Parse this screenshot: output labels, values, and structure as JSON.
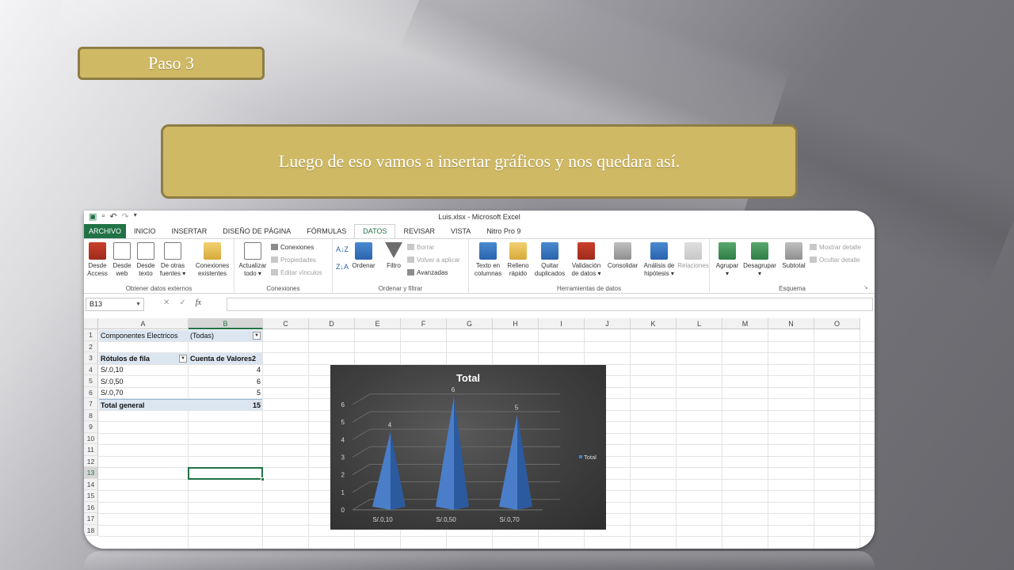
{
  "slide": {
    "step_label": "Paso 3",
    "caption": "Luego de eso vamos a insertar gráficos y nos quedara así."
  },
  "excel": {
    "window_title": "Luis.xlsx - Microsoft Excel",
    "tabs": [
      "ARCHIVO",
      "INICIO",
      "INSERTAR",
      "DISEÑO DE PÁGINA",
      "FÓRMULAS",
      "DATOS",
      "REVISAR",
      "VISTA",
      "Nitro Pro 9"
    ],
    "active_tab": "DATOS",
    "ribbon": {
      "obtener": {
        "label": "Obtener datos externos",
        "desde_access": [
          "Desde",
          "Access"
        ],
        "desde_web": [
          "Desde",
          "web"
        ],
        "desde_texto": [
          "Desde",
          "texto"
        ],
        "otras_fuentes": [
          "De otras",
          "fuentes ▾"
        ],
        "conexiones_existentes": [
          "Conexiones",
          "existentes"
        ]
      },
      "conexiones": {
        "label": "Conexiones",
        "actualizar": [
          "Actualizar",
          "todo ▾"
        ],
        "conexiones": "Conexiones",
        "propiedades": "Propiedades",
        "editar_vinculos": "Editar vínculos"
      },
      "ordenar": {
        "label": "Ordenar y filtrar",
        "ordenar": "Ordenar",
        "filtro": "Filtro",
        "borrar": "Borrar",
        "volver_aplicar": "Volver a aplicar",
        "avanzadas": "Avanzadas"
      },
      "herramientas": {
        "label": "Herramientas de datos",
        "texto_columnas": [
          "Texto en",
          "columnas"
        ],
        "relleno_rapido": [
          "Relleno",
          "rápido"
        ],
        "quitar_duplicados": [
          "Quitar",
          "duplicados"
        ],
        "validacion": [
          "Validación",
          "de datos ▾"
        ],
        "consolidar": "Consolidar",
        "analisis": [
          "Análisis de",
          "hipótesis ▾"
        ],
        "relaciones": "Relaciones"
      },
      "esquema": {
        "label": "Esquema",
        "agrupar": [
          "Agrupar",
          "▾"
        ],
        "desagrupar": [
          "Desagrupar",
          "▾"
        ],
        "subtotal": "Subtotal",
        "mostrar_detalle": "Mostrar detalle",
        "ocultar_detalle": "Ocultar detalle"
      }
    },
    "formula_bar": {
      "name_box": "B13",
      "cancel": "✕",
      "enter": "✓",
      "fx": "fx",
      "value": ""
    },
    "columns": [
      "A",
      "B",
      "C",
      "D",
      "E",
      "F",
      "G",
      "H",
      "I",
      "J",
      "K",
      "L",
      "M",
      "N",
      "O"
    ],
    "rows": [
      "1",
      "2",
      "3",
      "4",
      "5",
      "6",
      "7",
      "8",
      "9",
      "10",
      "11",
      "12",
      "13",
      "14",
      "15",
      "16",
      "17",
      "18"
    ],
    "selected_cell": {
      "column": "B",
      "row": "13"
    },
    "pivot": {
      "filter_label": "Componentes Electricos",
      "filter_value": "(Todas)",
      "row_header": "Rótulos de fila",
      "value_header": "Cuenta de Valores2",
      "items": [
        {
          "label": "S/.0,10",
          "value": "4"
        },
        {
          "label": "S/.0,50",
          "value": "6"
        },
        {
          "label": "S/.0,70",
          "value": "5"
        }
      ],
      "total_label": "Total general",
      "total_value": "15"
    }
  },
  "chart_data": {
    "type": "bar",
    "bar_shape": "3d-cone",
    "title": "Total",
    "categories": [
      "S/.0,10",
      "S/.0,50",
      "S/.0,70"
    ],
    "series": [
      {
        "name": "Total",
        "values": [
          4,
          6,
          5
        ]
      }
    ],
    "data_labels": [
      "4",
      "6",
      "5"
    ],
    "ylim": [
      0,
      6
    ],
    "y_ticks": [
      "0",
      "1",
      "2",
      "3",
      "4",
      "5",
      "6"
    ],
    "legend_position": "right",
    "grid": true,
    "colors": {
      "background": "#404040",
      "series": "#4a7ec8",
      "text": "#d9d9d9"
    }
  }
}
